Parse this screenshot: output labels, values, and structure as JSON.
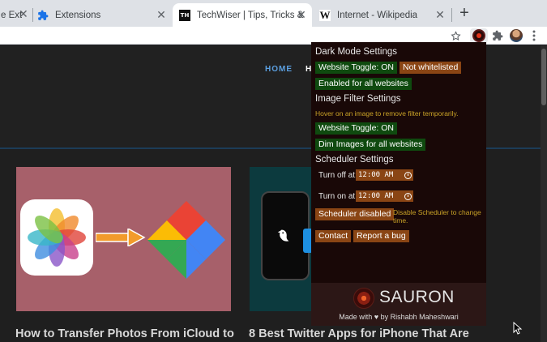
{
  "tabs": [
    {
      "title": "e Ext",
      "active": false
    },
    {
      "title": "Extensions",
      "active": false
    },
    {
      "title": "TechWiser | Tips, Tricks & How",
      "active": true,
      "favicon_text": "TH"
    },
    {
      "title": "Internet - Wikipedia",
      "active": false,
      "favicon_text": "W"
    }
  ],
  "toolbar": {
    "icons": [
      "star-icon",
      "sauron-extension-icon",
      "puzzle-icon",
      "profile-avatar",
      "menu-dots-icon"
    ]
  },
  "page": {
    "nav": {
      "home": "HOME",
      "next_partial": "H"
    },
    "articles": [
      {
        "title": "How to Transfer Photos From iCloud to"
      },
      {
        "title": "8 Best Twitter Apps for iPhone That Are"
      }
    ]
  },
  "popup": {
    "dark_mode": {
      "title": "Dark Mode Settings",
      "website_toggle": "Website Toggle: ON",
      "whitelist": "Not whitelisted",
      "all_websites": "Enabled for all websites"
    },
    "image_filter": {
      "title": "Image Filter Settings",
      "hint": "Hover on an image to remove filter temporarily.",
      "website_toggle": "Website Toggle: ON",
      "dim_images": "Dim Images for all websites"
    },
    "scheduler": {
      "title": "Scheduler Settings",
      "turn_off_label": "Turn off at:",
      "turn_off_value": "12:00 AM",
      "turn_on_label": "Turn on at:",
      "turn_on_value": "12:00 AM",
      "disabled_button": "Scheduler disabled",
      "disabled_hint_line1": "Disable Scheduler to change",
      "disabled_hint_line2": "time."
    },
    "contact": "Contact",
    "report_bug": "Report a bug",
    "brand": "SAURON",
    "made_with": "Made with ♥ by Rishabh Maheshwari"
  },
  "colors": {
    "popup_bg": "#190807",
    "green_button": "#0f4a0f",
    "brown_button": "#8a4514",
    "hint_text": "#c9a227",
    "nav_accent": "#5b9fe0"
  }
}
